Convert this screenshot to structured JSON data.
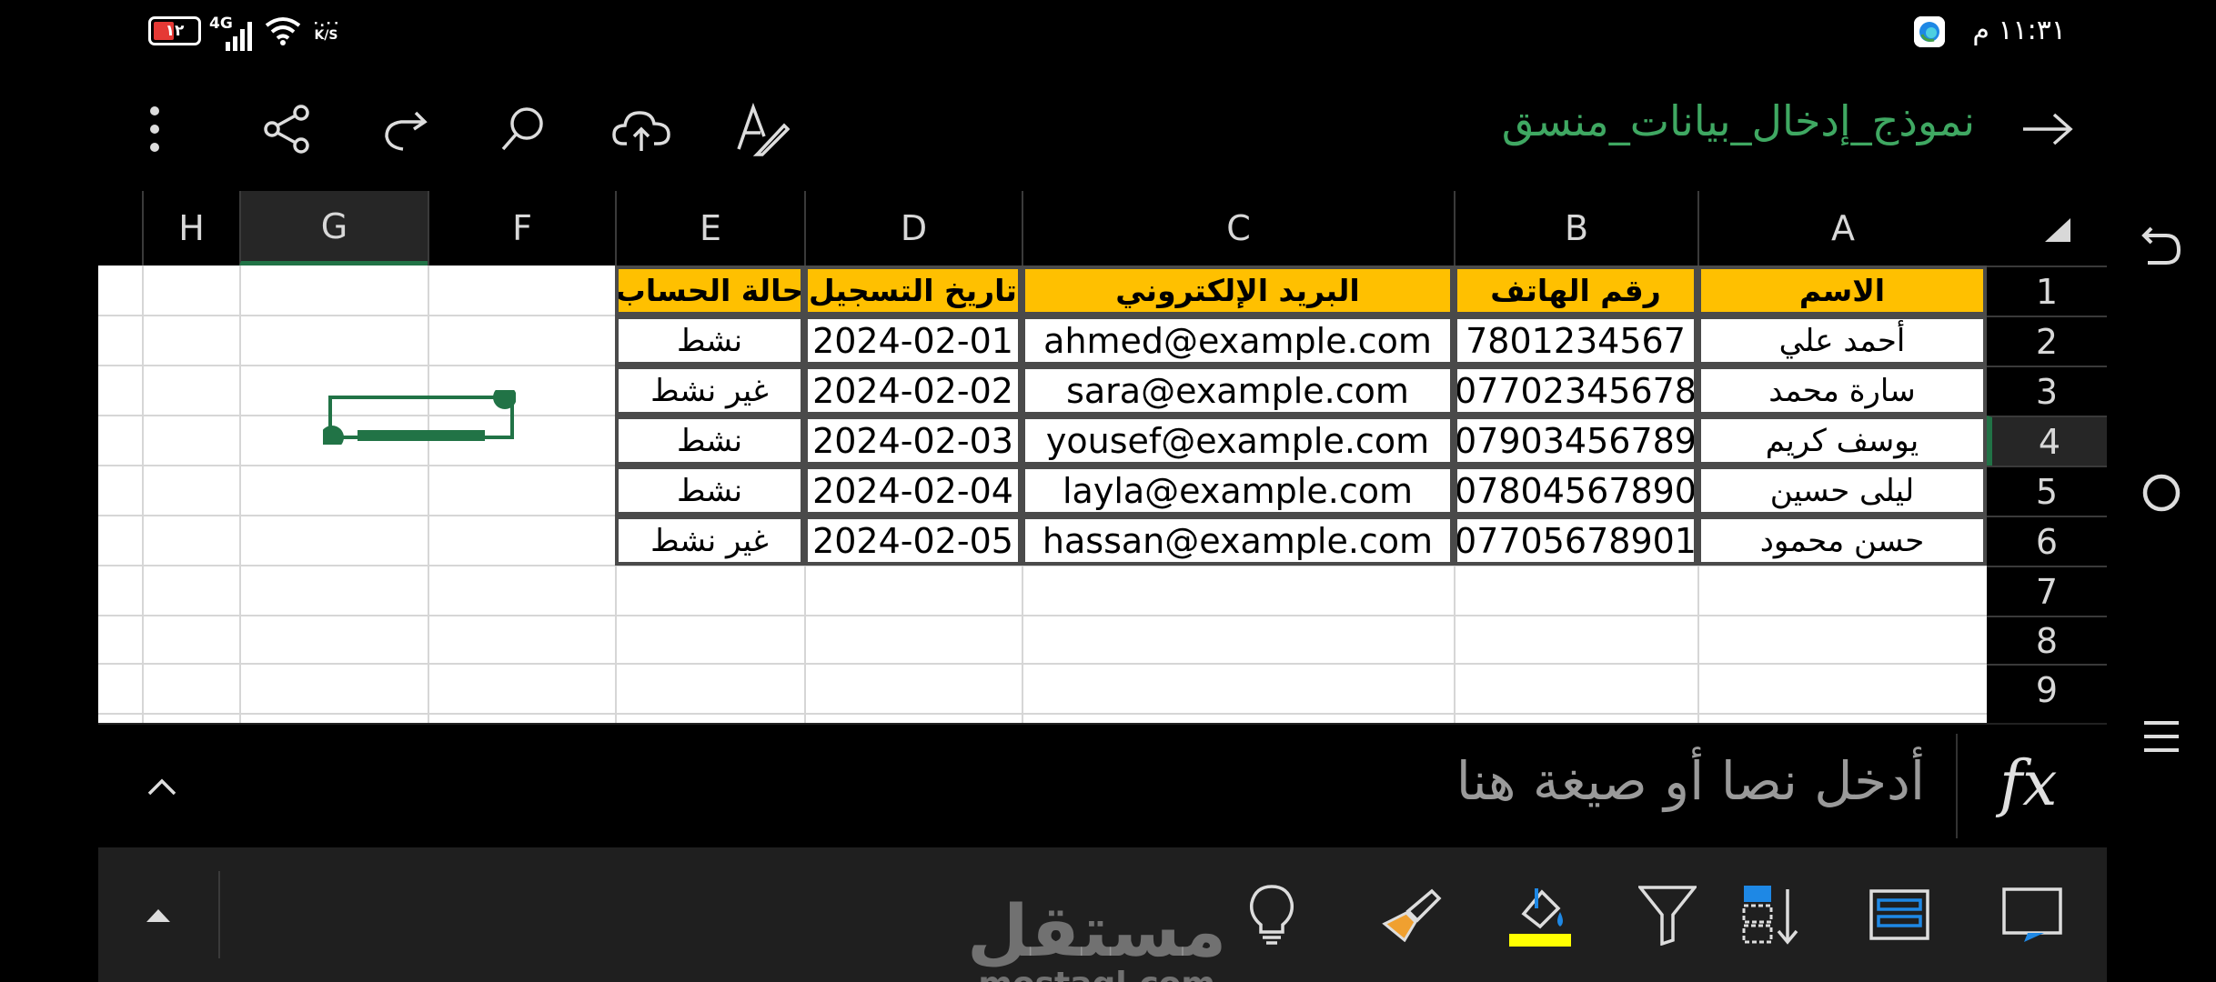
{
  "status_bar": {
    "battery": "١٢",
    "network": "4G",
    "speed_value": "٠.٠٠",
    "speed_unit": "K/S",
    "time": "١١:٣١ م"
  },
  "toolbar": {
    "title": "نموذج_إدخال_بيانات_منسق",
    "icons": [
      "more-icon",
      "share-icon",
      "redo-icon",
      "search-icon",
      "cloud-upload-icon",
      "text-format-icon",
      "back-arrow-icon"
    ]
  },
  "grid": {
    "columns": [
      "H",
      "G",
      "F",
      "E",
      "D",
      "C",
      "B",
      "A"
    ],
    "selected_column": "G",
    "rows": [
      "1",
      "2",
      "3",
      "4",
      "5",
      "6",
      "7",
      "8",
      "9"
    ],
    "selected_row": "4",
    "headers": {
      "A": "الاسم",
      "B": "رقم الهاتف",
      "C": "البريد الإلكتروني",
      "D": "تاريخ التسجيل",
      "E": "حالة الحساب"
    },
    "data": [
      {
        "A": "أحمد علي",
        "B": "7801234567",
        "C": "ahmed@example.com",
        "D": "2024-02-01",
        "E": "نشط"
      },
      {
        "A": "سارة محمد",
        "B": "07702345678",
        "C": "sara@example.com",
        "D": "2024-02-02",
        "E": "غير نشط"
      },
      {
        "A": "يوسف كريم",
        "B": "07903456789",
        "C": "yousef@example.com",
        "D": "2024-02-03",
        "E": "نشط"
      },
      {
        "A": "ليلى حسين",
        "B": "07804567890",
        "C": "layla@example.com",
        "D": "2024-02-04",
        "E": "نشط"
      },
      {
        "A": "حسن محمود",
        "B": "07705678901",
        "C": "hassan@example.com",
        "D": "2024-02-05",
        "E": "غير نشط"
      }
    ],
    "header_fill": "#ffc000",
    "selection_color": "#217346"
  },
  "formula_bar": {
    "fx_label": "fx",
    "placeholder": "أدخل نصا أو صيغة هنا"
  },
  "ribbon": {
    "icons": [
      "expand-up-icon",
      "lightbulb-icon",
      "format-painter-icon",
      "fill-color-icon",
      "filter-icon",
      "sort-icon",
      "table-icon",
      "comment-icon"
    ],
    "fill_color": "#ffff00"
  },
  "watermark": {
    "arabic": "مستقل",
    "latin": "mostaql.com"
  },
  "nav": {
    "icons": [
      "back-icon",
      "home-icon",
      "menu-icon"
    ]
  }
}
